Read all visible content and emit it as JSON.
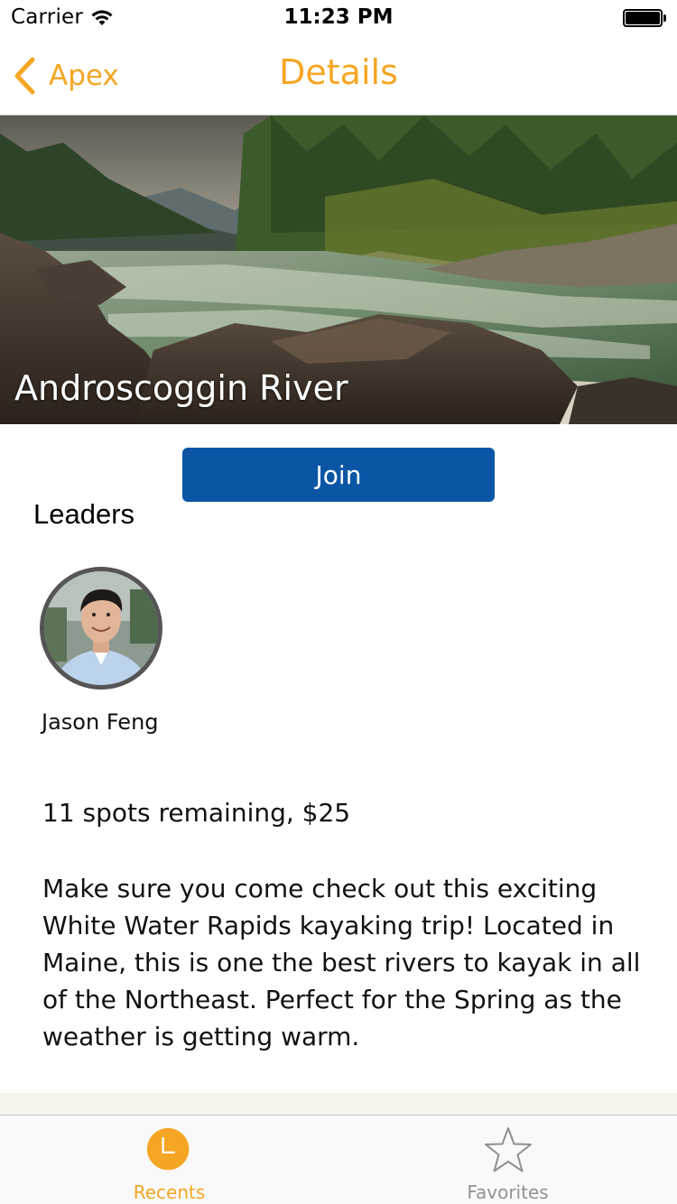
{
  "status_bar": {
    "carrier": "Carrier",
    "time": "11:23 PM"
  },
  "nav": {
    "back_label": "Apex",
    "title": "Details"
  },
  "hero": {
    "title": "Androscoggin River"
  },
  "join_label": "Join",
  "leaders": {
    "heading": "Leaders",
    "items": [
      {
        "name": "Jason Feng"
      }
    ]
  },
  "spots_text": "11 spots remaining, $25",
  "description": "Make sure you come check out this exciting White Water Rapids kayaking trip! Located in Maine, this is one the best rivers to kayak in all of the Northeast. Perfect for the Spring as the weather is getting warm.",
  "tabs": [
    {
      "label": "Recents",
      "icon": "clock-icon",
      "active": true
    },
    {
      "label": "Favorites",
      "icon": "star-icon",
      "active": false
    }
  ],
  "colors": {
    "accent": "#f5a623",
    "join_button": "#0a56a5",
    "inactive_tab": "#929292"
  }
}
